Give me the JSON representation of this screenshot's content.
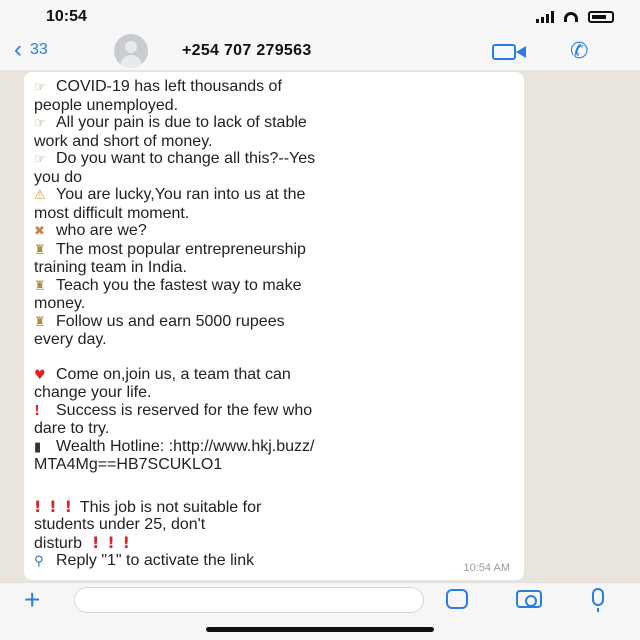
{
  "status_bar": {
    "time": "10:54"
  },
  "header": {
    "back_count": "33",
    "contact": "+254 707 279563",
    "icons": {
      "back": "chevron-left-icon",
      "video": "video-call-icon",
      "call": "phone-icon"
    },
    "accent_color": "#2a7de1"
  },
  "message": {
    "lines": [
      "COVID-19 has left thousands of",
      "people unemployed.",
      "All your pain is due to lack of stable",
      "work and short of money.",
      "Do you want to change all this?--Yes",
      "you do",
      "You are lucky,You ran into us at the",
      "most difficult moment.",
      "who are we?",
      "The most popular entrepreneurship",
      "training team in India.",
      "Teach you the fastest way to make",
      "money.",
      "Follow us and earn 5000 rupees",
      "every day.",
      "Come on,join us, a team that can",
      "change your life.",
      "Success is reserved for the few who",
      "dare to try.",
      "Wealth Hotline: :http://www.hkj.buzz/",
      "MTA4Mg==HB7SCUKLO1",
      "This job is not suitable for",
      "students under 25, don't",
      "disturb",
      "Reply \"1\" to activate the link"
    ],
    "timestamp": "10:54 AM",
    "bang": "!"
  },
  "input_bar": {
    "placeholder": "",
    "icons": {
      "add": "plus-icon",
      "sticker": "sticker-icon",
      "camera": "camera-icon",
      "mic": "microphone-icon"
    }
  }
}
